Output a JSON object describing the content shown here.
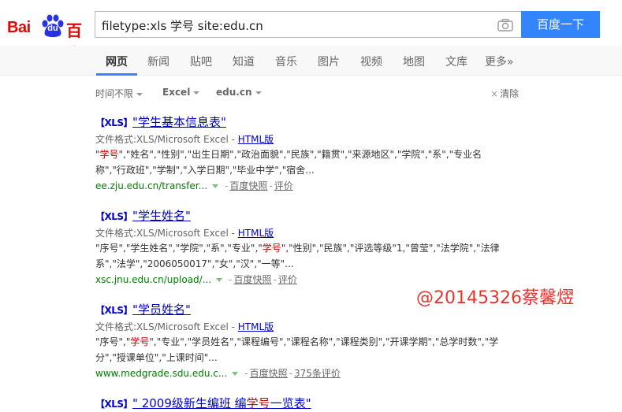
{
  "logo": {
    "text_latin": "Bai",
    "text_du": "du",
    "text_cn": "百度",
    "brand_color": "#e10602"
  },
  "search": {
    "query": "filetype:xls 学号 site:edu.cn",
    "button_label": "百度一下",
    "camera_icon": "camera-icon"
  },
  "nav": {
    "items": [
      {
        "label": "网页",
        "active": true
      },
      {
        "label": "新闻"
      },
      {
        "label": "贴吧"
      },
      {
        "label": "知道"
      },
      {
        "label": "音乐"
      },
      {
        "label": "图片"
      },
      {
        "label": "视频"
      },
      {
        "label": "地图"
      },
      {
        "label": "文库"
      },
      {
        "label": "更多»"
      }
    ]
  },
  "filters": {
    "time": "时间不限",
    "filetype": "Excel",
    "site": "edu.cn",
    "clear_label": "清除"
  },
  "results": [
    {
      "tag": "【XLS】",
      "title": "\"学生基本信息表\"",
      "format_label": "文件格式:XLS/Microsoft Excel - ",
      "html_label": "HTML版",
      "abstract_pre": "\"",
      "abstract_hl": "学号",
      "abstract_post": "\",\"姓名\",\"性别\",\"出生日期\",\"政治面貌\",\"民族\",\"籍贯\",\"来源地区\",\"学院\",\"系\",\"专业名称\",\"行政班\",\"学制\",\"入学日期\",\"毕业中学\",\"宿舍...",
      "url": "ee.zju.edu.cn/transfer...",
      "snapshot_label": "百度快照",
      "sep": "-",
      "extra_label": "评价"
    },
    {
      "tag": "【XLS】",
      "title": "\"学生姓名\"",
      "format_label": "文件格式:XLS/Microsoft Excel - ",
      "html_label": "HTML版",
      "abstract_pre": "\"序号\",\"学生姓名\",\"学院\",\"系\",\"专业\",\"",
      "abstract_hl": "学号",
      "abstract_post": "\",\"性别\",\"民族\",\"评选等级\"1,\"曾莹\",\"法学院\",\"法律系\",\"法学\",\"2006050017\",\"女\",\"汉\",\"一等\"...",
      "url": "xsc.jnu.edu.cn/upload/...",
      "snapshot_label": "百度快照",
      "sep": "-",
      "extra_label": "评价"
    },
    {
      "tag": "【XLS】",
      "title": "\"学员姓名\"",
      "format_label": "文件格式:XLS/Microsoft Excel - ",
      "html_label": "HTML版",
      "abstract_pre": "\"序号\",\"",
      "abstract_hl": "学号",
      "abstract_post": "\",\"专业\",\"学员姓名\",\"课程编号\",\"课程名称\",\"课程类别\",\"开课学期\",\"总学时数\",\"学分\",\"授课单位\",\"上课时间\"...",
      "url": "www.medgrade.sdu.edu.c...",
      "snapshot_label": "百度快照",
      "sep": "-",
      "extra_label": "375条评价"
    },
    {
      "tag": "【XLS】",
      "title_pre": "\" 2009级新生编班 编",
      "title_hl": "学号",
      "title_post": "一览表\""
    }
  ],
  "watermark": "@20145326蔡馨熤",
  "colors": {
    "accent": "#3385ff",
    "link": "#0000cc",
    "highlight": "#cc0000",
    "url": "#008000"
  }
}
